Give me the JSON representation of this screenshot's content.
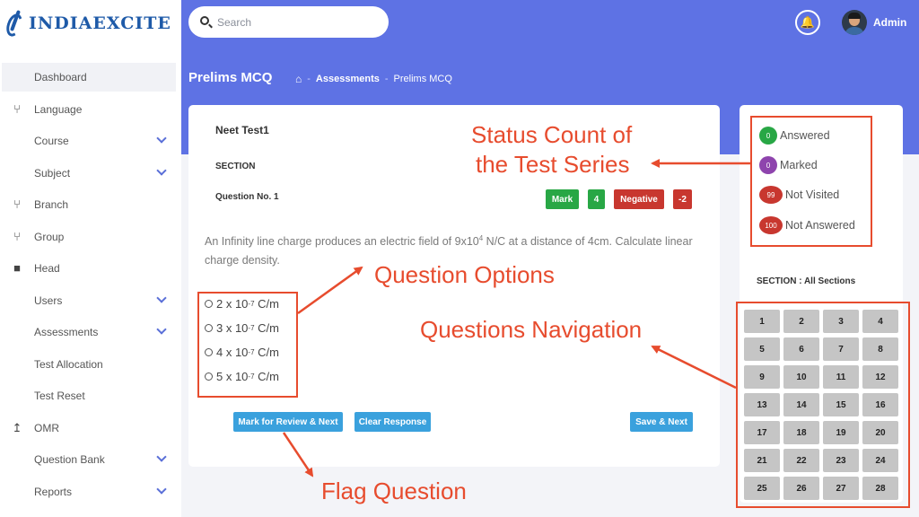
{
  "logo": {
    "text": "INDIAEXCITE"
  },
  "sidebar": {
    "items": [
      {
        "label": "Dashboard",
        "icon": "",
        "chevron": false,
        "active": true
      },
      {
        "label": "Language",
        "icon": "branch-icon",
        "chevron": false
      },
      {
        "label": "Course",
        "icon": "",
        "chevron": true
      },
      {
        "label": "Subject",
        "icon": "",
        "chevron": true
      },
      {
        "label": "Branch",
        "icon": "branch-icon",
        "chevron": false
      },
      {
        "label": "Group",
        "icon": "branch-icon",
        "chevron": false
      },
      {
        "label": "Head",
        "icon": "briefcase-icon",
        "chevron": false
      },
      {
        "label": "Users",
        "icon": "",
        "chevron": true
      },
      {
        "label": "Assessments",
        "icon": "",
        "chevron": true
      },
      {
        "label": "Test Allocation",
        "icon": "",
        "chevron": false
      },
      {
        "label": "Test Reset",
        "icon": "",
        "chevron": false
      },
      {
        "label": "OMR",
        "icon": "upload-icon",
        "chevron": false
      },
      {
        "label": "Question Bank",
        "icon": "",
        "chevron": true
      },
      {
        "label": "Reports",
        "icon": "",
        "chevron": true
      }
    ]
  },
  "header": {
    "search_placeholder": "Search",
    "user_name": "Admin",
    "page_title": "Prelims MCQ",
    "breadcrumb": [
      "Assessments",
      "Prelims MCQ"
    ]
  },
  "question": {
    "test_name": "Neet Test1",
    "section_label": "SECTION",
    "number_label": "Question No. 1",
    "mark_label": "Mark",
    "mark_value": "4",
    "negative_label": "Negative",
    "negative_value": "-2",
    "text_before": "An Infinity line charge produces an electric field of 9x10",
    "text_exp": "4",
    "text_after": " N/C at a distance of 4cm. Calculate linear charge density.",
    "options": [
      {
        "base": "2 x 10",
        "exp": "-7",
        "unit": " C/m"
      },
      {
        "base": "3 x 10",
        "exp": "-7",
        "unit": " C/m"
      },
      {
        "base": "4 x 10",
        "exp": "-7",
        "unit": " C/m"
      },
      {
        "base": "5 x 10",
        "exp": "-7",
        "unit": " C/m"
      }
    ],
    "buttons": {
      "review": "Mark for Review & Next",
      "clear": "Clear Response",
      "save": "Save & Next"
    }
  },
  "status": {
    "items": [
      {
        "count": "0",
        "label": "Answered",
        "color": "#28a745"
      },
      {
        "count": "0",
        "label": "Marked",
        "color": "#8e44ad"
      },
      {
        "count": "99",
        "label": "Not Visited",
        "color": "#c8372f"
      },
      {
        "count": "100",
        "label": "Not Answered",
        "color": "#c8372f"
      }
    ],
    "section_label": "SECTION : All Sections",
    "questions": [
      "1",
      "2",
      "3",
      "4",
      "5",
      "6",
      "7",
      "8",
      "9",
      "10",
      "11",
      "12",
      "13",
      "14",
      "15",
      "16",
      "17",
      "18",
      "19",
      "20",
      "21",
      "22",
      "23",
      "24",
      "25",
      "26",
      "27",
      "28"
    ]
  },
  "annotations": {
    "status_count": [
      "Status Count of",
      "the Test Series"
    ],
    "question_options": "Question Options",
    "questions_navigation": "Questions Navigation",
    "flag_question": "Flag Question"
  },
  "colors": {
    "header": "#5e72e4",
    "annotation": "#e74c2e",
    "button": "#3aa1dd"
  }
}
